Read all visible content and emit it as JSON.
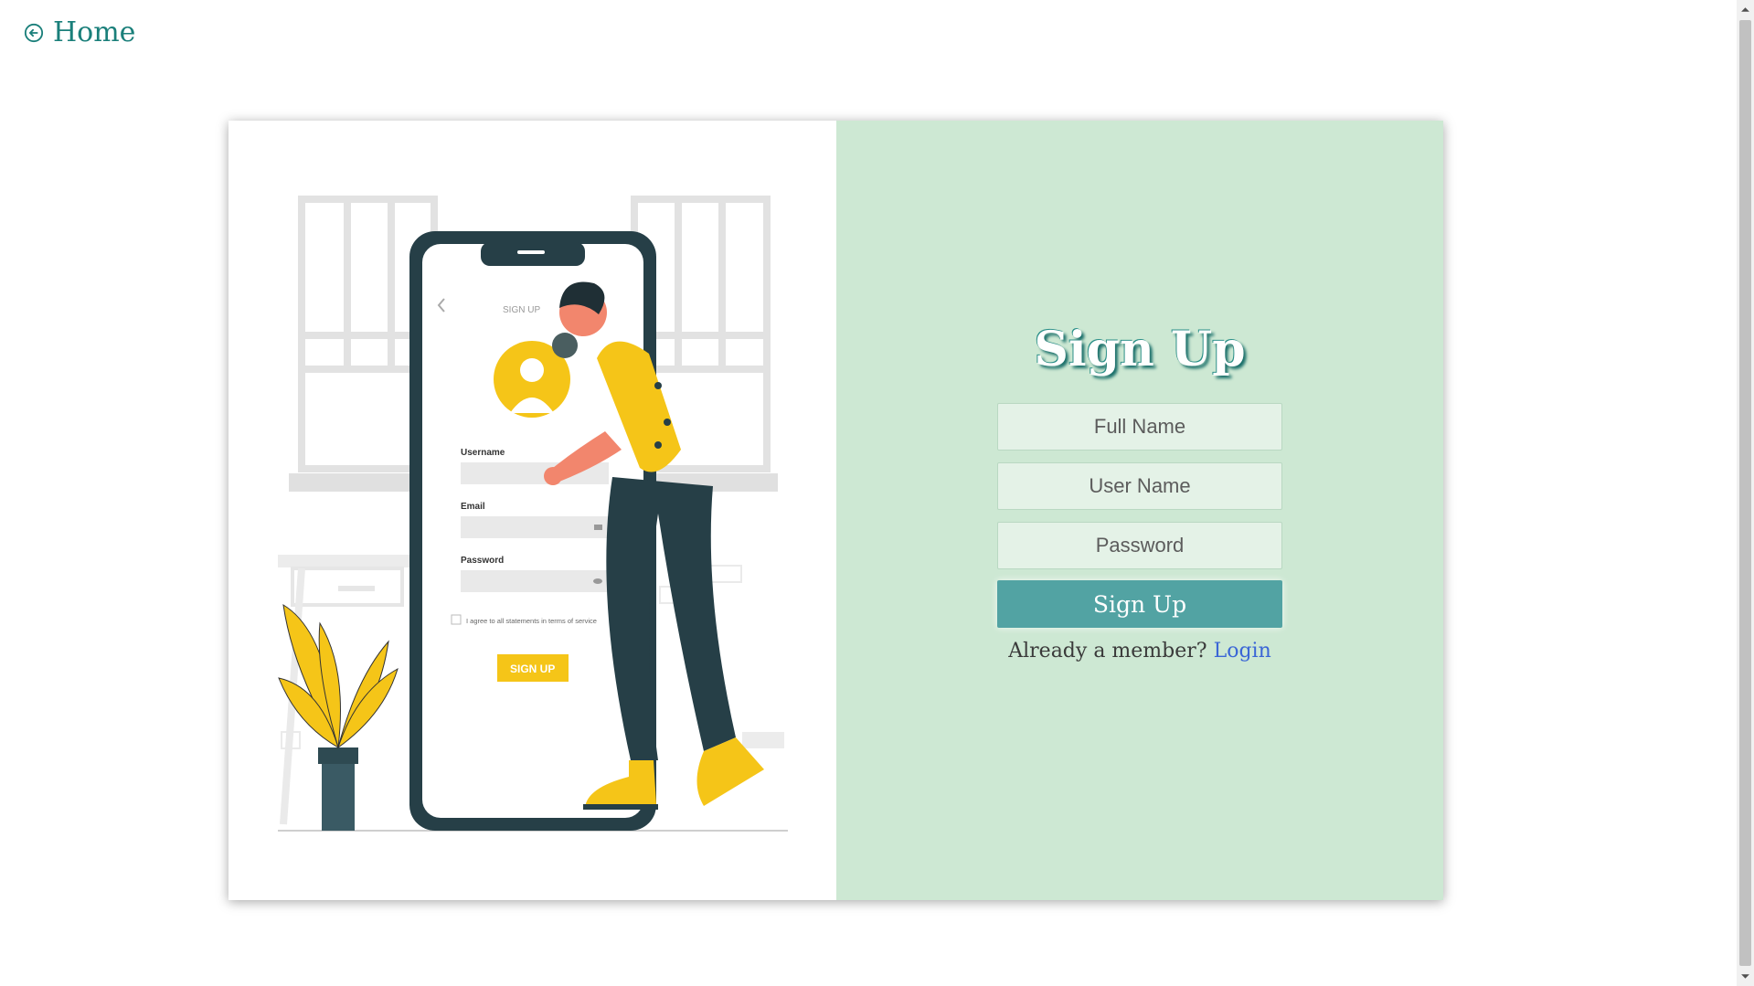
{
  "nav": {
    "home_label": "Home"
  },
  "illustration": {
    "phone_title": "SIGN UP",
    "username_label": "Username",
    "email_label": "Email",
    "password_label": "Password",
    "terms_text": "I agree to all statements in terms of service",
    "button_label": "SIGN UP"
  },
  "form": {
    "title": "Sign Up",
    "full_name_placeholder": "Full Name",
    "user_name_placeholder": "User Name",
    "password_placeholder": "Password",
    "submit_label": "Sign Up",
    "member_text": "Already a member?",
    "login_label": "Login"
  },
  "colors": {
    "accent": "#1a7f7a",
    "panel_bg": "#cde8d3",
    "button_bg": "#52a3a3",
    "link": "#3b66d6",
    "illustration_yellow": "#f5c518",
    "illustration_dark": "#263f47"
  }
}
